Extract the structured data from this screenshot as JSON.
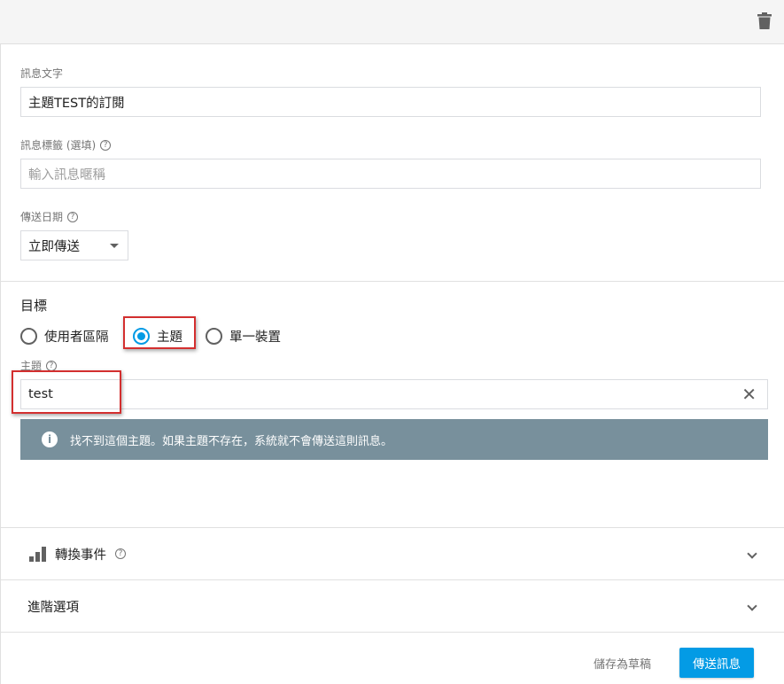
{
  "header": {
    "delete_icon": "trash-icon"
  },
  "message_text": {
    "label": "訊息文字",
    "value": "主題TEST的訂閱"
  },
  "message_label": {
    "label": "訊息標籤 (選填)",
    "placeholder": "輸入訊息暱稱"
  },
  "send_date": {
    "label": "傳送日期",
    "selected": "立即傳送"
  },
  "target": {
    "title": "目標",
    "options": [
      {
        "label": "使用者區隔",
        "checked": false
      },
      {
        "label": "主題",
        "checked": true
      },
      {
        "label": "單一裝置",
        "checked": false
      }
    ],
    "topic_label": "主題",
    "topic_value": "test",
    "warning": "找不到這個主題。如果主題不存在，系統就不會傳送這則訊息。"
  },
  "conversion": {
    "label": "轉換事件"
  },
  "advanced": {
    "label": "進階選項"
  },
  "footer": {
    "draft_label": "儲存為草稿",
    "send_label": "傳送訊息"
  },
  "colors": {
    "accent": "#039be5",
    "banner": "#78909c",
    "highlight": "#d32f2f"
  }
}
